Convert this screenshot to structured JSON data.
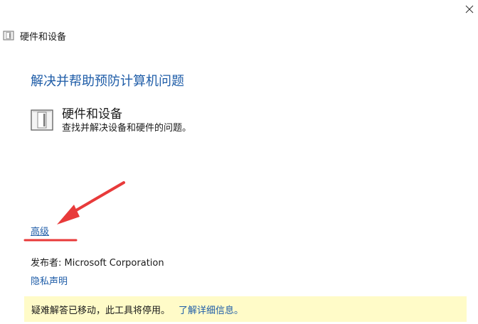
{
  "window": {
    "title": "硬件和设备",
    "close_icon": "close-icon"
  },
  "main": {
    "heading": "解决并帮助预防计算机问题",
    "tool": {
      "icon": "hardware-devices-icon",
      "name": "硬件和设备",
      "description": "查找并解决设备和硬件的问题。"
    },
    "advanced_link": "高级"
  },
  "footer": {
    "publisher": "发布者: Microsoft Corporation",
    "privacy_link": "隐私声明"
  },
  "notice": {
    "text": "疑难解答已移动，此工具将停用。",
    "link": "了解详细信息。"
  },
  "annotation": {
    "color": "#e83a3a"
  },
  "colors": {
    "link": "#1f5da8",
    "notice_background": "#fffbc8"
  }
}
